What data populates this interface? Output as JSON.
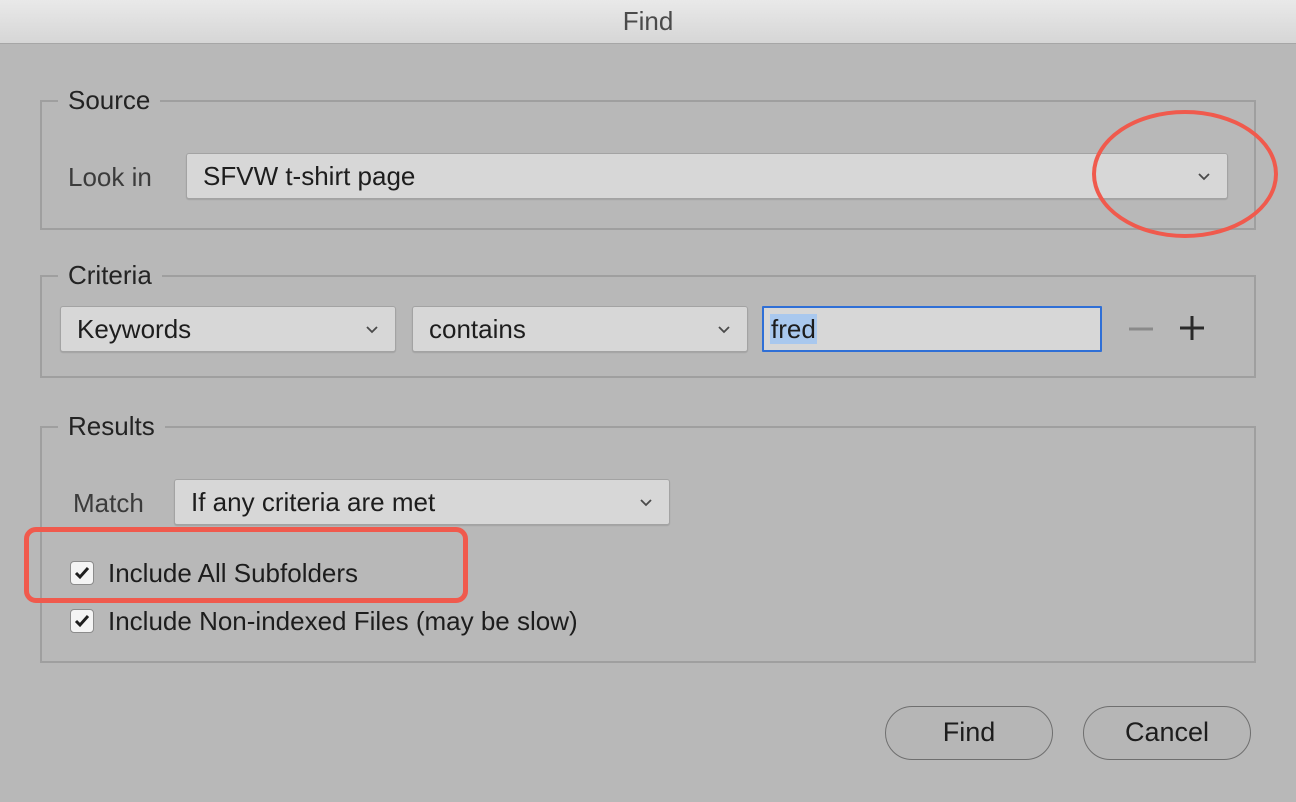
{
  "window": {
    "title": "Find"
  },
  "source": {
    "legend": "Source",
    "look_in_label": "Look in",
    "look_in_value": "SFVW t-shirt page"
  },
  "criteria": {
    "legend": "Criteria",
    "field_value": "Keywords",
    "operator_value": "contains",
    "search_value": "fred"
  },
  "results": {
    "legend": "Results",
    "match_label": "Match",
    "match_value": "If any criteria are met",
    "include_subfolders_label": "Include All Subfolders",
    "include_subfolders_checked": true,
    "include_nonindexed_label": "Include Non-indexed Files (may be slow)",
    "include_nonindexed_checked": true
  },
  "buttons": {
    "find_label": "Find",
    "cancel_label": "Cancel"
  },
  "colors": {
    "annotation": "#f05a4d",
    "focus_ring": "#2f6fd6",
    "background": "#b8b8b8"
  },
  "icons": [
    "chevron-down-icon",
    "minus-icon",
    "plus-icon",
    "checkmark-icon"
  ]
}
